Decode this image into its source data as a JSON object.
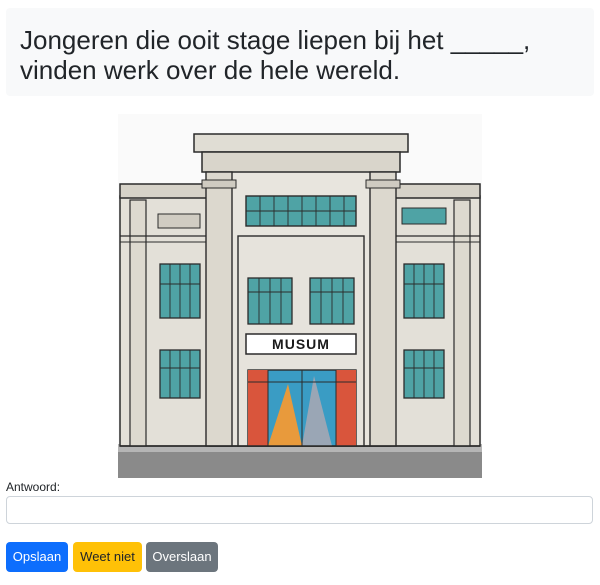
{
  "question": {
    "text": "Jongeren die ooit stage liepen bij het _____, vinden werk over de hele wereld."
  },
  "illustration": {
    "sign_text": "MUSUM",
    "colors": {
      "facade": "#e3e0d8",
      "outline": "#2b2b2b",
      "window_glass": "#4fa3a5",
      "door_red": "#d9553c",
      "door_orange": "#e89a3c",
      "door_blue": "#3a9cc4",
      "ground": "#8a8a8a"
    }
  },
  "form": {
    "answer_label": "Antwoord:",
    "answer_value": "",
    "answer_placeholder": ""
  },
  "buttons": {
    "save_label": "Opslaan",
    "dontknow_label": "Weet niet",
    "skip_label": "Overslaan"
  },
  "colors": {
    "primary": "#0d6efd",
    "warning": "#ffc107",
    "secondary": "#6c757d",
    "question_bg": "#f8f9fa"
  }
}
